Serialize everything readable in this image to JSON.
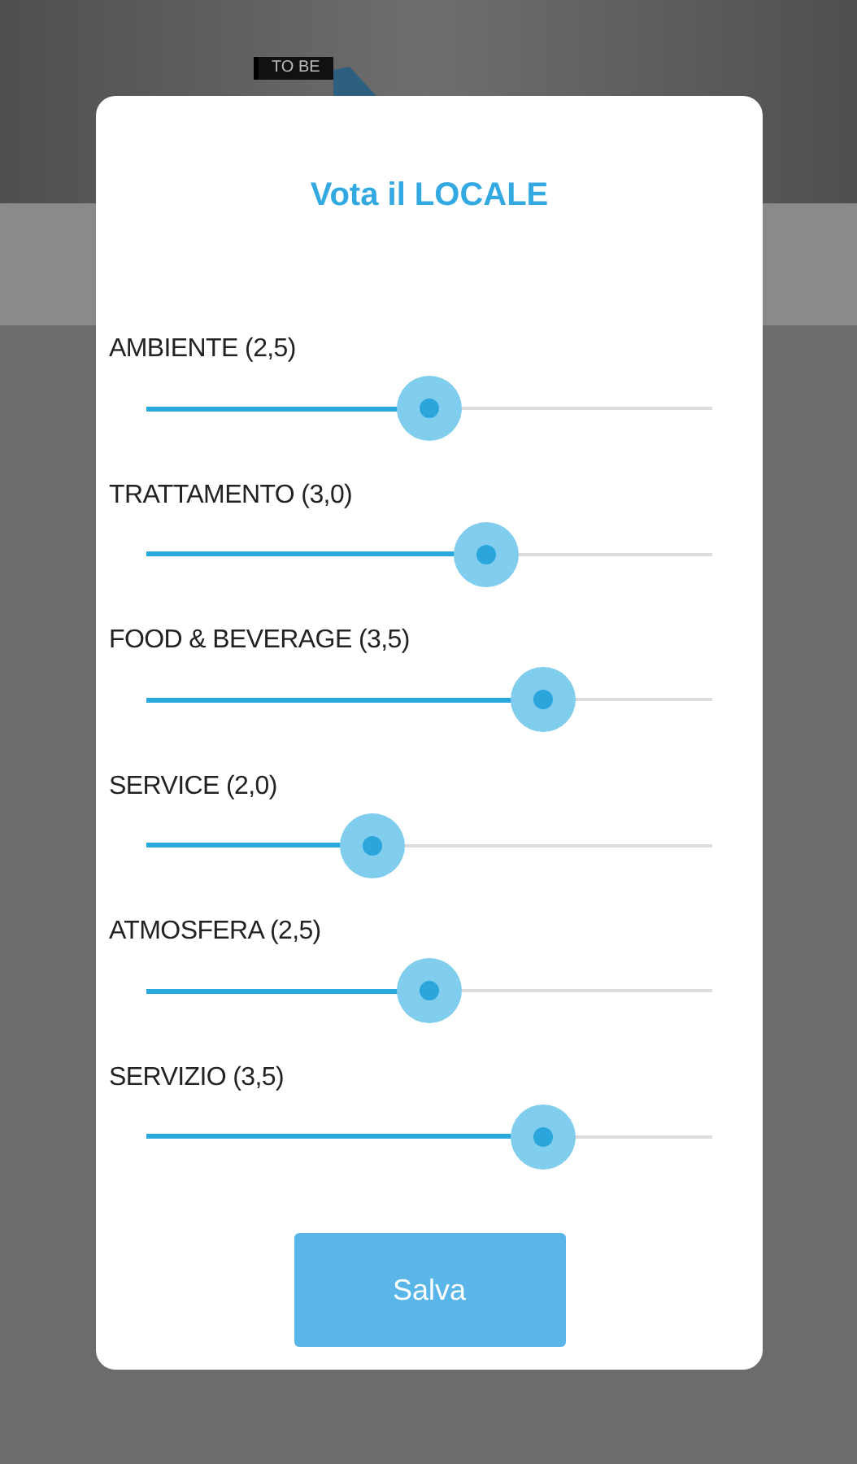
{
  "background": {
    "logo_tag": "TO BE"
  },
  "dialog": {
    "title": "Vota il LOCALE",
    "ratings": [
      {
        "label": "AMBIENTE (2,5)",
        "level": 0.5
      },
      {
        "label": "TRATTAMENTO (3,0)",
        "level": 0.6
      },
      {
        "label": "FOOD & BEVERAGE (3,5)",
        "level": 0.7
      },
      {
        "label": "SERVICE (2,0)",
        "level": 0.4
      },
      {
        "label": "ATMOSFERA (2,5)",
        "level": 0.5
      },
      {
        "label": "SERVIZIO (3,5)",
        "level": 0.7
      }
    ],
    "button": "Salva"
  }
}
